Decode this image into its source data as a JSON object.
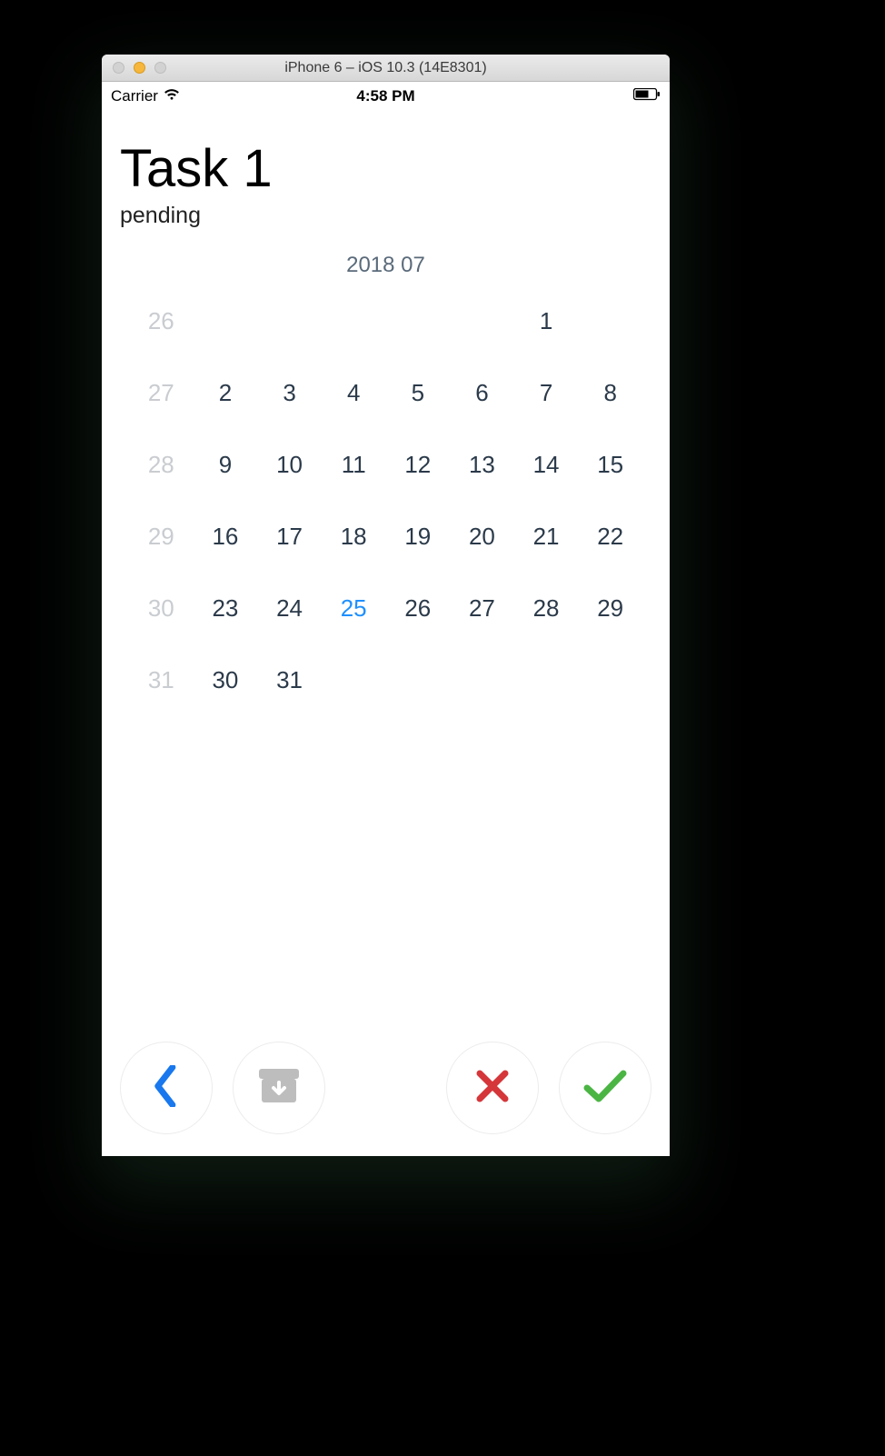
{
  "simulator": {
    "window_title": "iPhone 6 – iOS 10.3 (14E8301)"
  },
  "statusbar": {
    "carrier": "Carrier",
    "time": "4:58 PM"
  },
  "task": {
    "title": "Task 1",
    "status": "pending"
  },
  "calendar": {
    "header": "2018 07",
    "today": 25,
    "rows": [
      [
        {
          "n": 26,
          "muted": true
        },
        {
          "n": null
        },
        {
          "n": null
        },
        {
          "n": null
        },
        {
          "n": null
        },
        {
          "n": null
        },
        {
          "n": 1
        }
      ],
      [
        {
          "n": 27,
          "muted": true
        },
        {
          "n": 2
        },
        {
          "n": 3
        },
        {
          "n": 4
        },
        {
          "n": 5
        },
        {
          "n": 6
        },
        {
          "n": 7
        },
        {
          "n": 8
        }
      ],
      [
        {
          "n": 28,
          "muted": true
        },
        {
          "n": 9
        },
        {
          "n": 10
        },
        {
          "n": 11
        },
        {
          "n": 12
        },
        {
          "n": 13
        },
        {
          "n": 14
        },
        {
          "n": 15
        }
      ],
      [
        {
          "n": 29,
          "muted": true
        },
        {
          "n": 16
        },
        {
          "n": 17
        },
        {
          "n": 18
        },
        {
          "n": 19
        },
        {
          "n": 20
        },
        {
          "n": 21
        },
        {
          "n": 22
        }
      ],
      [
        {
          "n": 30,
          "muted": true
        },
        {
          "n": 23
        },
        {
          "n": 24
        },
        {
          "n": 25,
          "today": true
        },
        {
          "n": 26
        },
        {
          "n": 27
        },
        {
          "n": 28
        },
        {
          "n": 29
        }
      ],
      [
        {
          "n": 31,
          "muted": true
        },
        {
          "n": 30
        },
        {
          "n": 31
        },
        {
          "n": null
        },
        {
          "n": null
        },
        {
          "n": null
        },
        {
          "n": null
        },
        {
          "n": null
        }
      ]
    ]
  },
  "icons": {
    "back": "back-icon",
    "archive": "archive-icon",
    "cancel": "cancel-icon",
    "confirm": "confirm-icon",
    "wifi": "wifi-icon",
    "battery": "battery-icon"
  },
  "colors": {
    "accent_blue": "#1978ee",
    "success_green": "#4bb544",
    "danger_red": "#d5363a",
    "muted_gray": "#bdbdbd"
  }
}
